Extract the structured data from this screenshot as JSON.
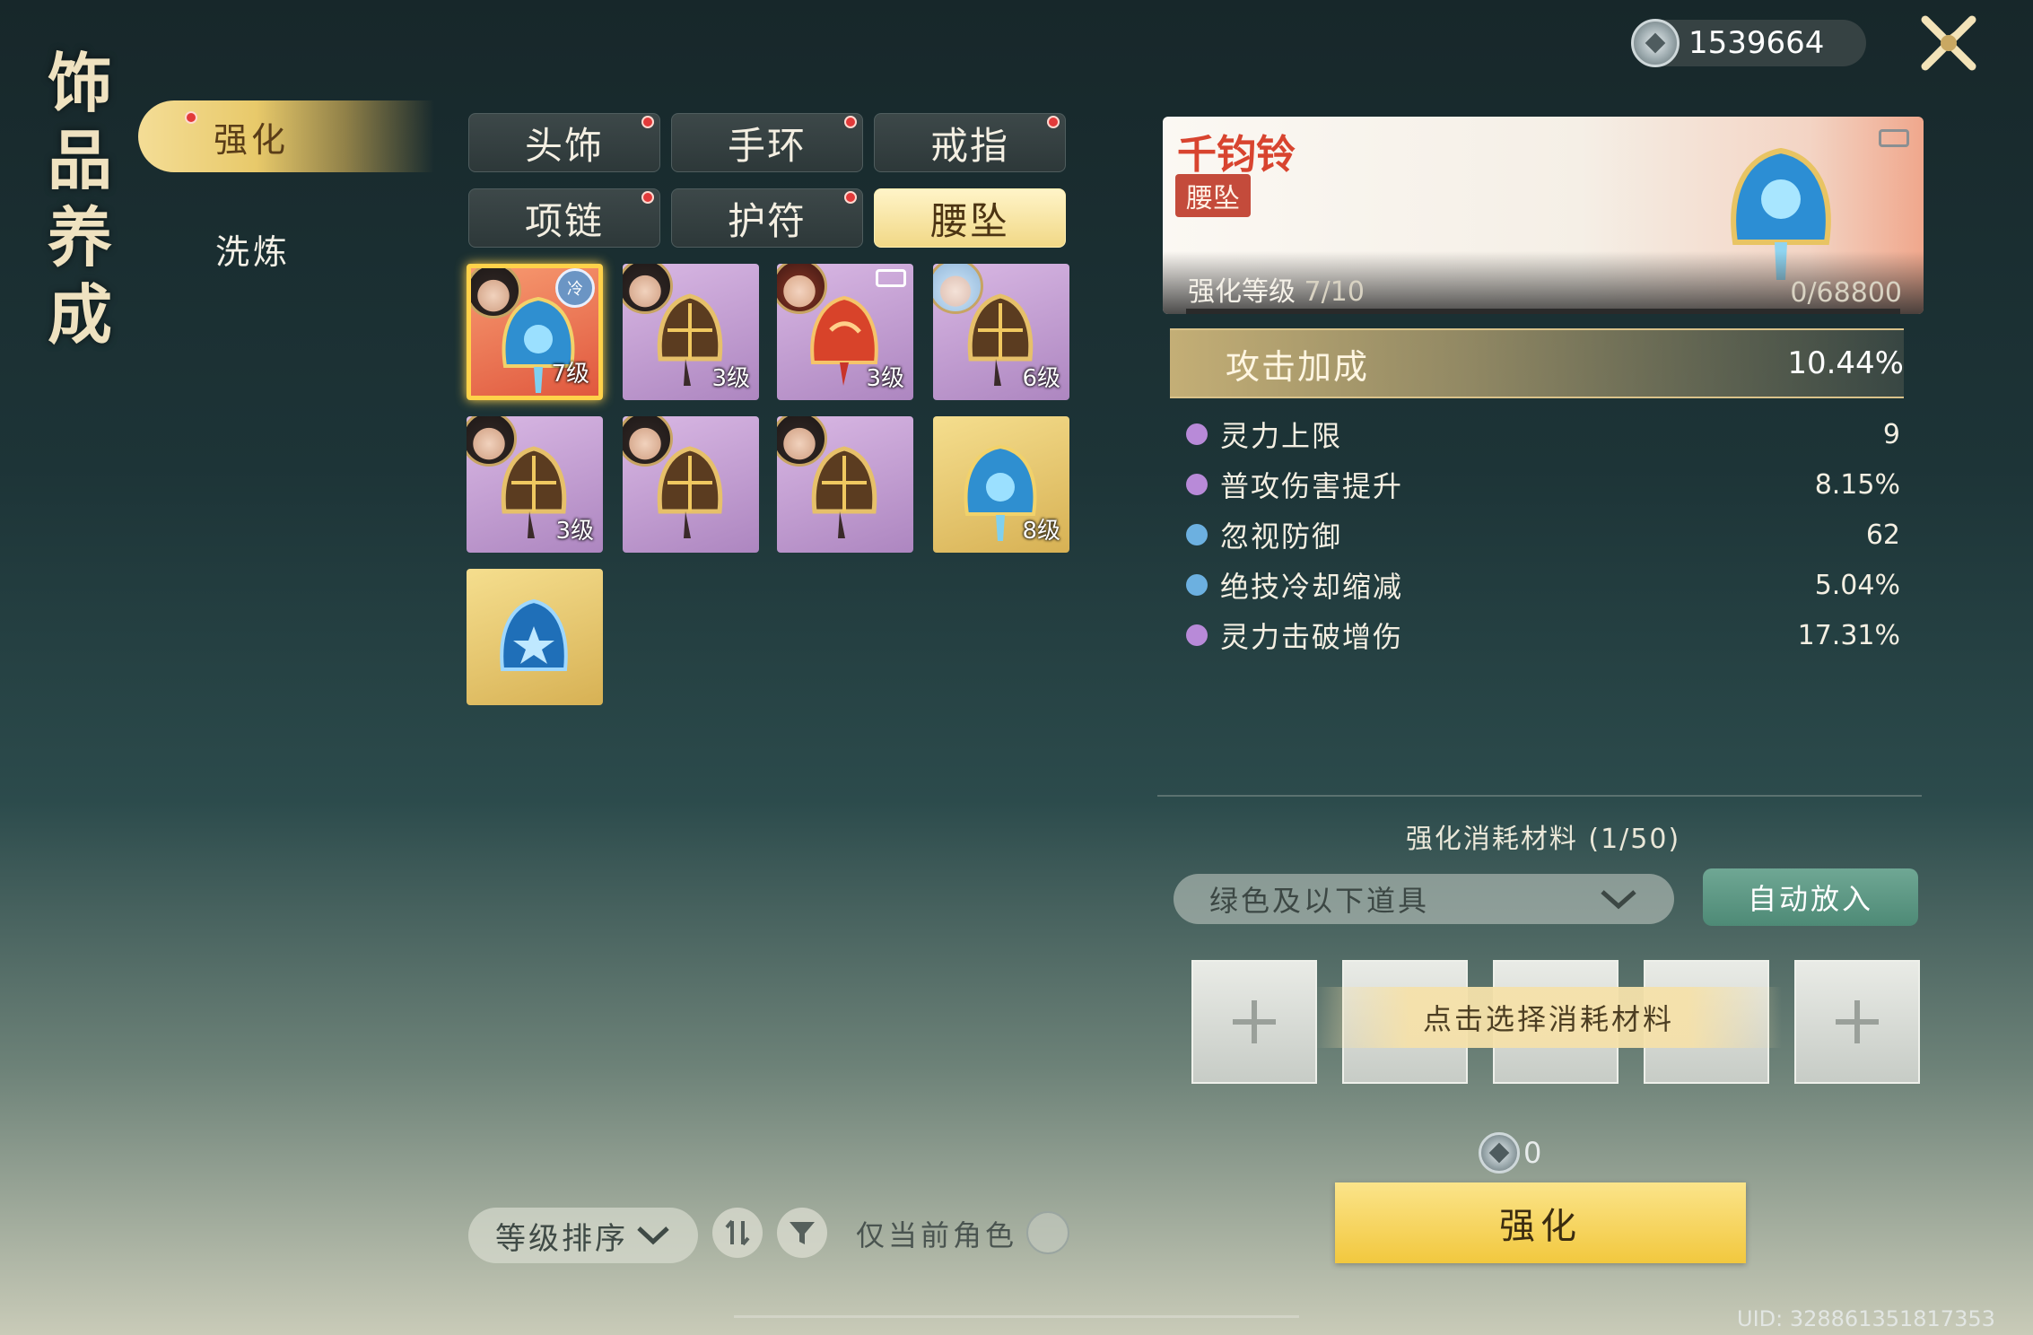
{
  "header": {
    "currency_amount": "1539664",
    "currency_icon": "silver-coin-icon",
    "close_icon": "close-x-icon"
  },
  "page_title": [
    "饰",
    "品",
    "养",
    "成"
  ],
  "sidebar": {
    "items": [
      {
        "label": "强化",
        "active": true,
        "badge": true
      },
      {
        "label": "洗炼",
        "active": false
      }
    ]
  },
  "tabs": [
    {
      "label": "头饰",
      "badge": true,
      "active": false
    },
    {
      "label": "手环",
      "badge": true,
      "active": false
    },
    {
      "label": "戒指",
      "badge": true,
      "active": false
    },
    {
      "label": "项链",
      "badge": true,
      "active": false
    },
    {
      "label": "护符",
      "badge": true,
      "active": false
    },
    {
      "label": "腰坠",
      "badge": false,
      "active": true
    }
  ],
  "items": [
    {
      "level": "7级",
      "quality": "orange",
      "avatar": "dark-hair",
      "selected": true
    },
    {
      "level": "3级",
      "quality": "purple",
      "avatar": "dark-hair"
    },
    {
      "level": "3级",
      "quality": "purple",
      "avatar": "red-hair"
    },
    {
      "level": "6级",
      "quality": "purple",
      "avatar": "silver-hair"
    },
    {
      "level": "3级",
      "quality": "purple",
      "avatar": "dark-hair"
    },
    {
      "level": "",
      "quality": "purple",
      "avatar": "dark-hair"
    },
    {
      "level": "",
      "quality": "purple",
      "avatar": "dark-hair"
    },
    {
      "level": "8级",
      "quality": "gold",
      "avatar": ""
    },
    {
      "level": "",
      "quality": "gold",
      "avatar": ""
    }
  ],
  "detail": {
    "name": "千钧铃",
    "type": "腰坠",
    "enhance_label": "强化等级",
    "enhance_value": "7/10",
    "exp": "0/68800",
    "exp_progress": 0,
    "main_stat": {
      "name": "攻击加成",
      "value": "10.44%"
    },
    "stats": [
      {
        "name": "灵力上限",
        "value": "9",
        "color": "#b88ad8"
      },
      {
        "name": "普攻伤害提升",
        "value": "8.15%",
        "color": "#b88ad8"
      },
      {
        "name": "忽视防御",
        "value": "62",
        "color": "#6cb0e0"
      },
      {
        "name": "绝技冷却缩减",
        "value": "5.04%",
        "color": "#6cb0e0"
      },
      {
        "name": "灵力击破增伤",
        "value": "17.31%",
        "color": "#b88ad8"
      }
    ]
  },
  "materials": {
    "title": "强化消耗材料 (1/50)",
    "filter_value": "绿色及以下道具",
    "auto_button": "自动放入",
    "slot_hint": "点击选择消耗材料",
    "slot_count": 5
  },
  "cost": "0",
  "enhance_button": "强化",
  "bottom": {
    "sort_label": "等级排序",
    "only_current_label": "仅当前角色"
  },
  "uid": "UID: 328861351817353",
  "colors": {
    "accent_gold": "#f2c83e",
    "badge_red": "#e23a3a",
    "auto_green": "#5a9a84"
  }
}
